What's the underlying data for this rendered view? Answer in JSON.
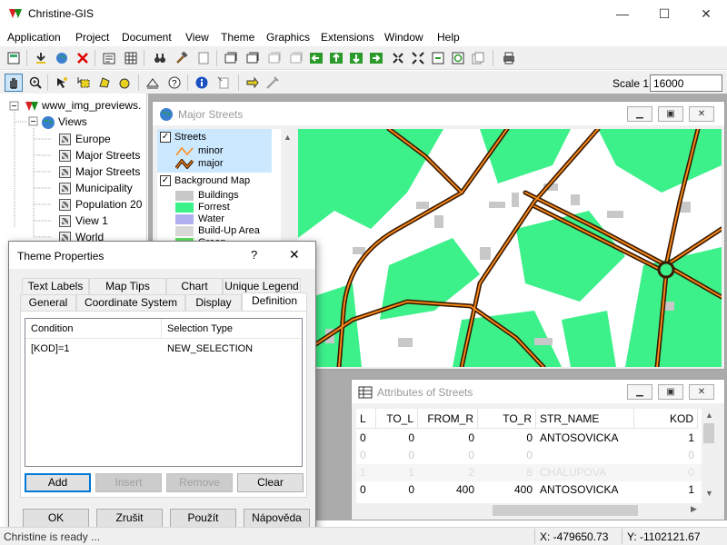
{
  "app": {
    "title": "Christine-GIS"
  },
  "window_controls": {
    "minimize": "—",
    "maximize": "☐",
    "close": "✕"
  },
  "menu": [
    "Application",
    "Project",
    "Document",
    "View",
    "Theme",
    "Graphics",
    "Extensions",
    "Window",
    "Help"
  ],
  "toolbar2": {
    "scale_label": "Scale 1:",
    "scale_value": "16000"
  },
  "tree": {
    "root": "www_img_previews.",
    "views": "Views",
    "items": [
      "Europe",
      "Major Streets",
      "Major Streets",
      "Municipality",
      "Population 20",
      "View 1",
      "World"
    ]
  },
  "map_window": {
    "title": "Major Streets",
    "legend": {
      "streets_label": "Streets",
      "streets_items": [
        "minor",
        "major"
      ],
      "background_label": "Background Map",
      "background_items": [
        {
          "label": "Buildings",
          "color": "#c8c8c8"
        },
        {
          "label": "Forrest",
          "color": "#3cf08a"
        },
        {
          "label": "Water",
          "color": "#b0b0f0"
        },
        {
          "label": "Build-Up Area",
          "color": "#d8d8d8"
        },
        {
          "label": "Green",
          "color": "#60e060"
        }
      ]
    }
  },
  "attr_window": {
    "title": "Attributes of Streets",
    "columns": [
      "L",
      "TO_L",
      "FROM_R",
      "TO_R",
      "STR_NAME",
      "KOD"
    ],
    "rows": [
      [
        "0",
        "0",
        "0",
        "0",
        "ANTOSOVICKA",
        "1"
      ],
      [
        "0",
        "0",
        "0",
        "0",
        "",
        "0"
      ],
      [
        "1",
        "1",
        "2",
        "8",
        "CHALUPOVA",
        "0"
      ],
      [
        "0",
        "0",
        "400",
        "400",
        "ANTOSOVICKA",
        "1"
      ]
    ]
  },
  "dialog": {
    "title": "Theme Properties",
    "help": "?",
    "close": "✕",
    "tabs_row1": [
      "Text Labels",
      "Map Tips",
      "Chart",
      "Unique Legend"
    ],
    "tabs_row2": [
      "General",
      "Coordinate System",
      "Display",
      "Definition"
    ],
    "columns": [
      "Condition",
      "Selection Type"
    ],
    "rows": [
      [
        "[KOD]=1",
        "NEW_SELECTION"
      ]
    ],
    "buttons": {
      "add": "Add",
      "insert": "Insert",
      "remove": "Remove",
      "clear": "Clear"
    },
    "footer": {
      "ok": "OK",
      "cancel": "Zrušit",
      "apply": "Použít",
      "help": "Nápověda"
    }
  },
  "status": {
    "message": "Christine is ready ...",
    "x": "X:  -479650.73",
    "y": "Y:  -1102121.67"
  },
  "colors": {
    "forest": "#3cf08a",
    "street_major": "#8b2500",
    "street_orange": "#ff8c1a",
    "accent": "#0078d7"
  }
}
